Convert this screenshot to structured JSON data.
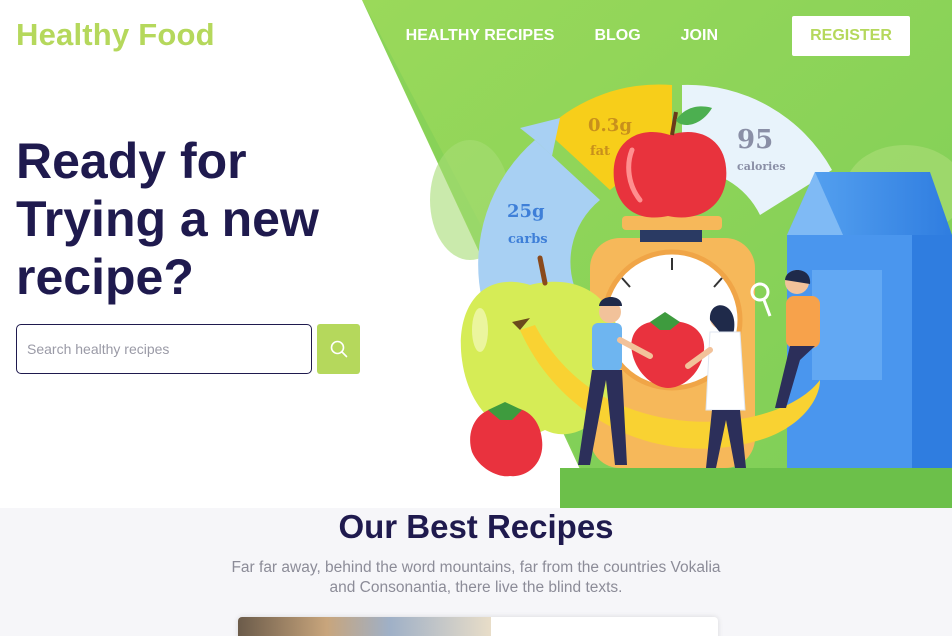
{
  "brand": {
    "logo_text": "Healthy Food"
  },
  "nav": {
    "items": [
      {
        "label": "HEALTHY RECIPES"
      },
      {
        "label": "BLOG"
      },
      {
        "label": "JOIN"
      }
    ],
    "register_label": "REGISTER"
  },
  "hero": {
    "headline": "Ready for Trying a new recipe?",
    "search_placeholder": "Search healthy recipes",
    "search_icon": "search-icon",
    "illustration": {
      "fat_value": "0.3g",
      "fat_label": "fat",
      "calories_value": "95",
      "calories_label": "calories",
      "carbs_value": "25g",
      "carbs_label": "carbs"
    }
  },
  "section": {
    "title": "Our Best Recipes",
    "description": "Far far away, behind the word mountains, far from the countries Vokalia and Consonantia, there live the blind texts."
  },
  "colors": {
    "accent": "#b5d85c",
    "dark": "#1f1a4e",
    "green": "#8bd35a",
    "muted": "#8c8c98"
  }
}
